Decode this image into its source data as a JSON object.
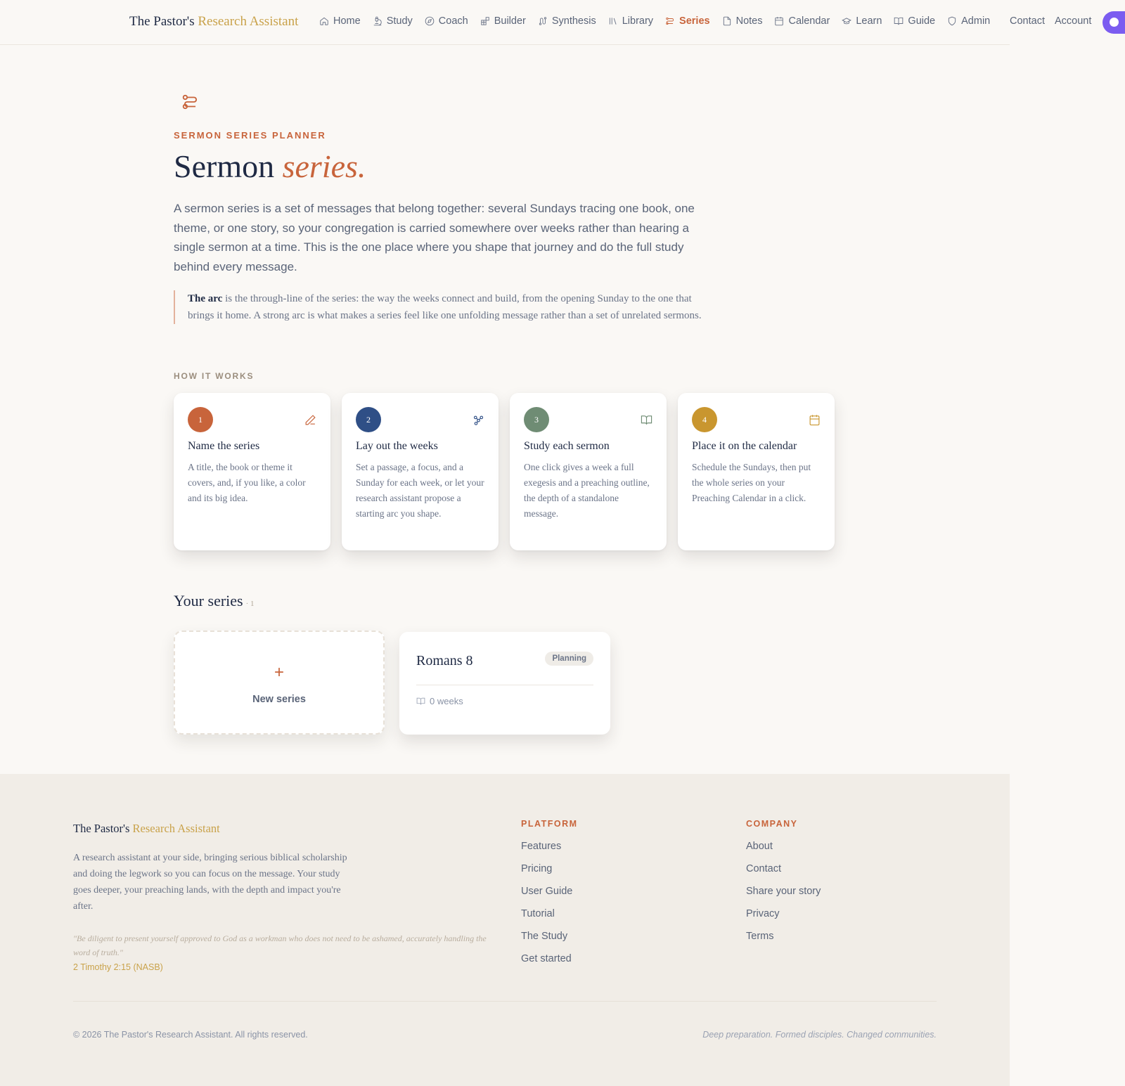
{
  "nav": {
    "brand_main": "The Pastor's",
    "brand_accent": "Research Assistant",
    "items": [
      {
        "label": "Home",
        "icon": "home-icon"
      },
      {
        "label": "Study",
        "icon": "microscope-icon"
      },
      {
        "label": "Coach",
        "icon": "compass-icon"
      },
      {
        "label": "Builder",
        "icon": "blocks-icon"
      },
      {
        "label": "Synthesis",
        "icon": "route-icon"
      },
      {
        "label": "Library",
        "icon": "library-icon"
      },
      {
        "label": "Series",
        "icon": "series-icon",
        "active": true
      },
      {
        "label": "Notes",
        "icon": "file-icon"
      },
      {
        "label": "Calendar",
        "icon": "calendar-icon"
      },
      {
        "label": "Learn",
        "icon": "graduation-cap-icon"
      },
      {
        "label": "Guide",
        "icon": "book-open-icon"
      },
      {
        "label": "Admin",
        "icon": "shield-icon"
      }
    ],
    "contact": "Contact",
    "account": "Account"
  },
  "hero": {
    "eyebrow": "SERMON SERIES PLANNER",
    "title_main": "Sermon",
    "title_accent": "series.",
    "lead": "A sermon series is a set of messages that belong together: several Sundays tracing one book, one theme, or one story, so your congregation is carried somewhere over weeks rather than hearing a single sermon at a time. This is the one place where you shape that journey and do the full study behind every message.",
    "quote_bold": "The arc",
    "quote_rest": " is the through-line of the series: the way the weeks connect and build, from the opening Sunday to the one that brings it home. A strong arc is what makes a series feel like one unfolding message rather than a set of unrelated sermons."
  },
  "how_it_works": {
    "label": "HOW IT WORKS",
    "steps": [
      {
        "num": "1",
        "title": "Name the series",
        "text": "A title, the book or theme it covers, and, if you like, a color and its big idea.",
        "color": "#c8643b",
        "icon": "pencil-icon"
      },
      {
        "num": "2",
        "title": "Lay out the weeks",
        "text": "Set a passage, a focus, and a Sunday for each week, or let your research assistant propose a starting arc you shape.",
        "color": "#2f4f86",
        "icon": "workflow-icon"
      },
      {
        "num": "3",
        "title": "Study each sermon",
        "text": "One click gives a week a full exegesis and a preaching outline, the depth of a standalone message.",
        "color": "#6f8c74",
        "icon": "book-open-icon"
      },
      {
        "num": "4",
        "title": "Place it on the calendar",
        "text": "Schedule the Sundays, then put the whole series on your Preaching Calendar in a click.",
        "color": "#c9962f",
        "icon": "calendar-icon"
      }
    ]
  },
  "your_series": {
    "heading": "Your series",
    "count": "· 1",
    "new_plus": "+",
    "new_label": "New series",
    "items": [
      {
        "title": "Romans 8",
        "status": "Planning",
        "weeks": "0 weeks"
      }
    ]
  },
  "footer": {
    "brand_main": "The Pastor's",
    "brand_accent": "Research Assistant",
    "description": "A research assistant at your side, bringing serious biblical scholarship and doing the legwork so you can focus on the message. Your study goes deeper, your preaching lands, with the depth and impact you're after.",
    "verse": "\"Be diligent to present yourself approved to God as a workman who does not need to be ashamed, accurately handling the word of truth.\"",
    "verse_ref": "2 Timothy 2:15 (NASB)",
    "platform_heading": "PLATFORM",
    "platform_links": [
      "Features",
      "Pricing",
      "User Guide",
      "Tutorial",
      "The Study",
      "Get started"
    ],
    "company_heading": "COMPANY",
    "company_links": [
      "About",
      "Contact",
      "Share your story",
      "Privacy",
      "Terms"
    ],
    "copyright": "© 2026 The Pastor's Research Assistant. All rights reserved.",
    "tagline": "Deep preparation. Formed disciples. Changed communities."
  },
  "colors": {
    "accent": "#c8643b",
    "gold": "#c9a24a",
    "ink": "#1f2a44",
    "avatar": "#7b5cf0"
  }
}
